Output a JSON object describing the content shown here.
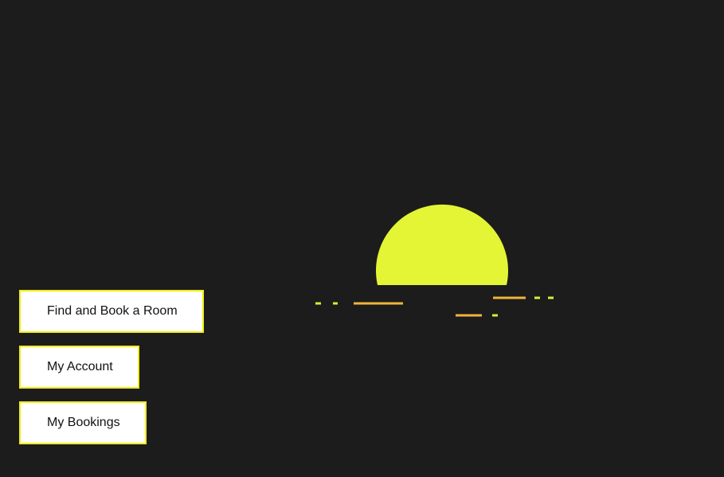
{
  "menu": {
    "find_room_label": "Find and Book a Room",
    "my_account_label": "My Account",
    "my_bookings_label": "My Bookings"
  },
  "colors": {
    "background": "#1c1c1c",
    "sun": "#e3f534",
    "reflection_orange": "#f0b43a",
    "reflection_yellow": "#d8ee35",
    "button_border": "#f2ee13",
    "button_fill": "#ffffff"
  },
  "illustration": {
    "name": "sunset-over-water-icon"
  }
}
